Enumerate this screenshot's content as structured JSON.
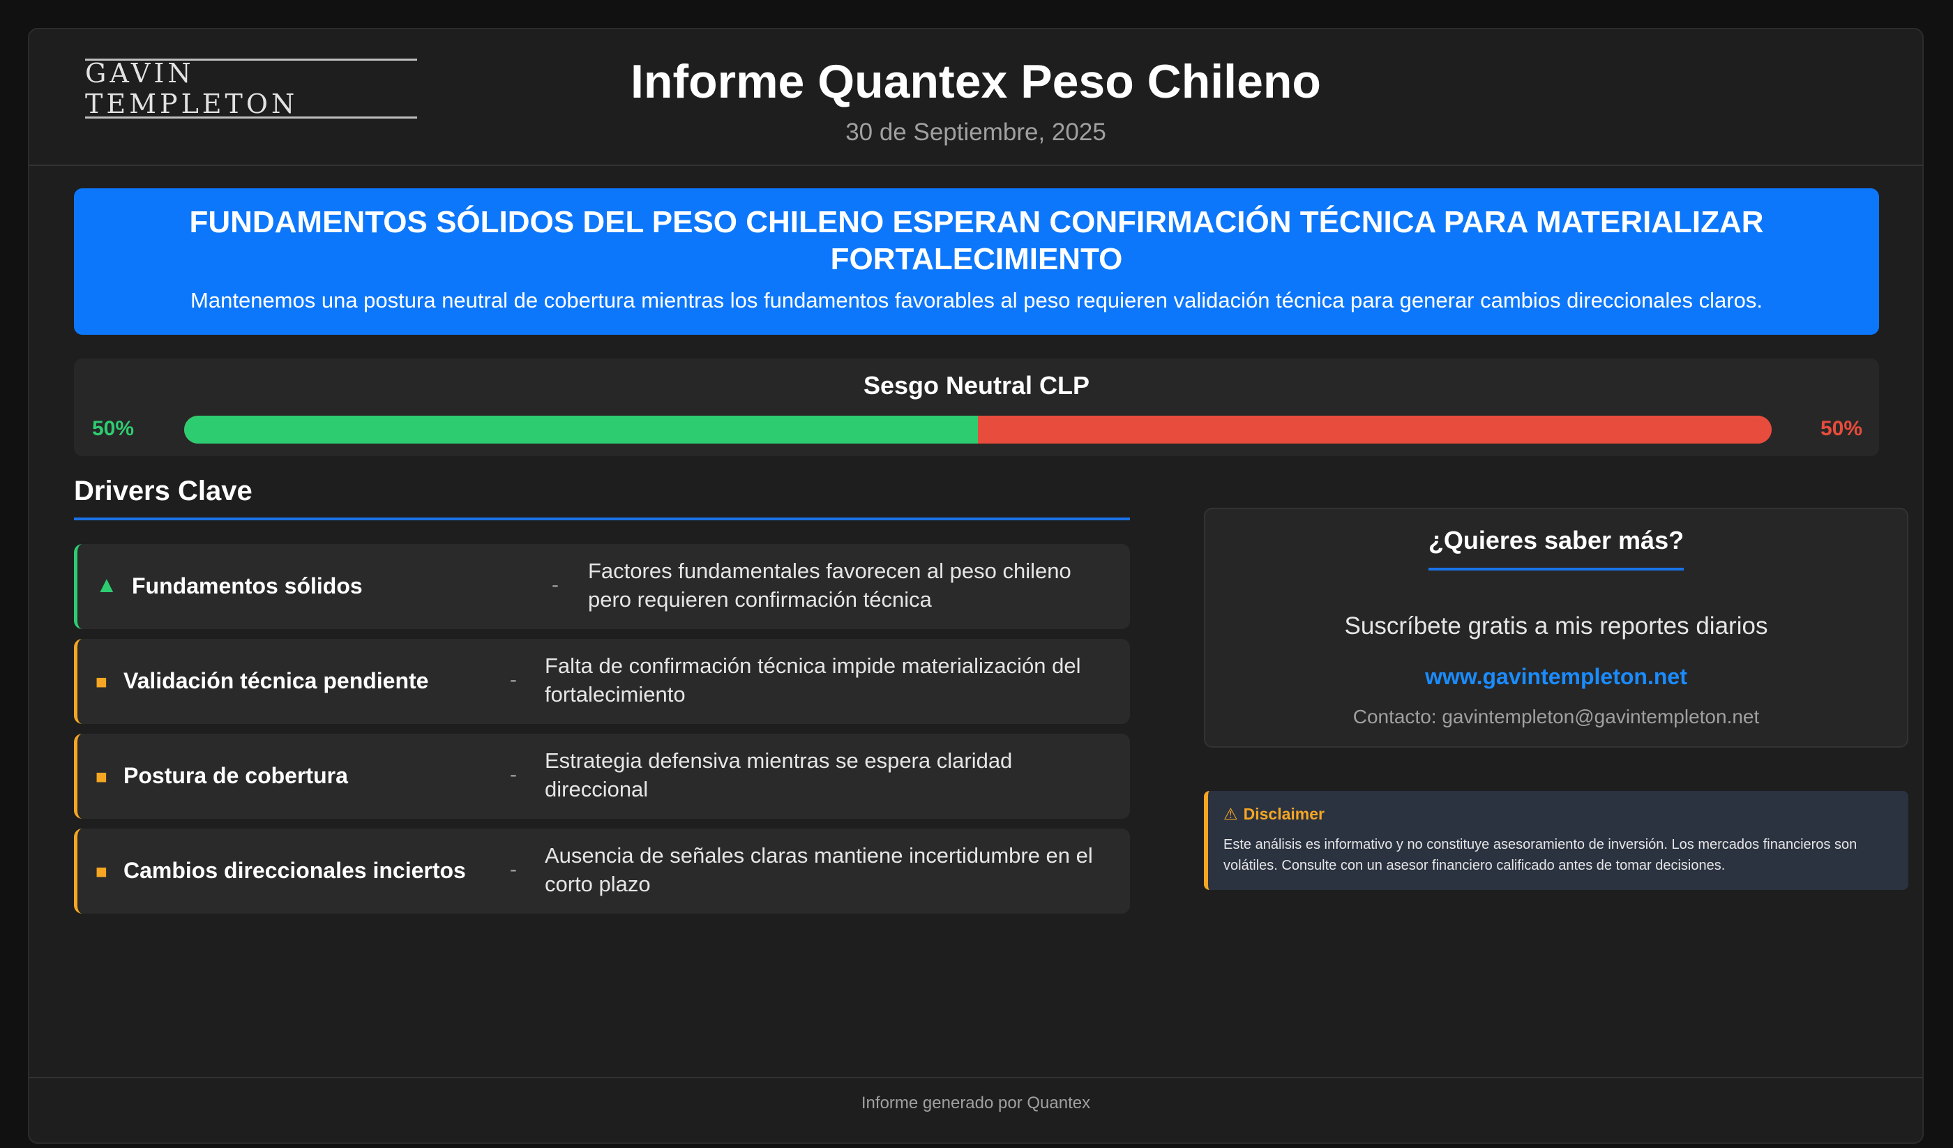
{
  "header": {
    "logo": "GAVIN TEMPLETON",
    "title": "Informe Quantex Peso Chileno",
    "date": "30 de Septiembre, 2025"
  },
  "banner": {
    "headline": "FUNDAMENTOS SÓLIDOS DEL PESO CHILENO ESPERAN CONFIRMACIÓN TÉCNICA PARA MATERIALIZAR FORTALECIMIENTO",
    "subtext": "Mantenemos una postura neutral de cobertura mientras los fundamentos favorables al peso requieren validación técnica para generar cambios direccionales claros."
  },
  "bias": {
    "title": "Sesgo Neutral CLP",
    "left_label": "50%",
    "right_label": "50%",
    "left_value": 50,
    "right_value": 50,
    "left_color": "#2ecc71",
    "right_color": "#e74c3c"
  },
  "drivers": {
    "title": "Drivers Clave",
    "items": [
      {
        "marker": "▲",
        "marker_icon": "triangle-up-icon",
        "name": "Fundamentos sólidos",
        "dash": "-",
        "desc": "Factores fundamentales favorecen al peso chileno pero requieren confirmación técnica"
      },
      {
        "marker": "■",
        "marker_icon": "square-icon",
        "name": "Validación técnica pendiente",
        "dash": "-",
        "desc": "Falta de confirmación técnica impide materialización del fortalecimiento"
      },
      {
        "marker": "■",
        "marker_icon": "square-icon",
        "name": "Postura de cobertura",
        "dash": "-",
        "desc": "Estrategia defensiva mientras se espera claridad direccional"
      },
      {
        "marker": "■",
        "marker_icon": "square-icon",
        "name": "Cambios direccionales inciertos",
        "dash": "-",
        "desc": "Ausencia de señales claras mantiene incertidumbre en el corto plazo"
      }
    ]
  },
  "cta": {
    "title": "¿Quieres saber más?",
    "text": "Suscríbete gratis a mis reportes diarios",
    "link": "www.gavintempleton.net",
    "contact": "Contacto: gavintempleton@gavintempleton.net"
  },
  "disclaimer": {
    "icon": "warning-icon",
    "title": "Disclaimer",
    "body": "Este análisis es informativo y no constituye asesoramiento de inversión. Los mercados financieros son volátiles. Consulte con un asesor financiero calificado antes de tomar decisiones."
  },
  "footer": {
    "text": "Informe generado por Quantex"
  },
  "colors": {
    "accent_blue": "#0d77fb",
    "positive": "#2ecc71",
    "negative": "#e74c3c",
    "warning": "#f5a623"
  }
}
